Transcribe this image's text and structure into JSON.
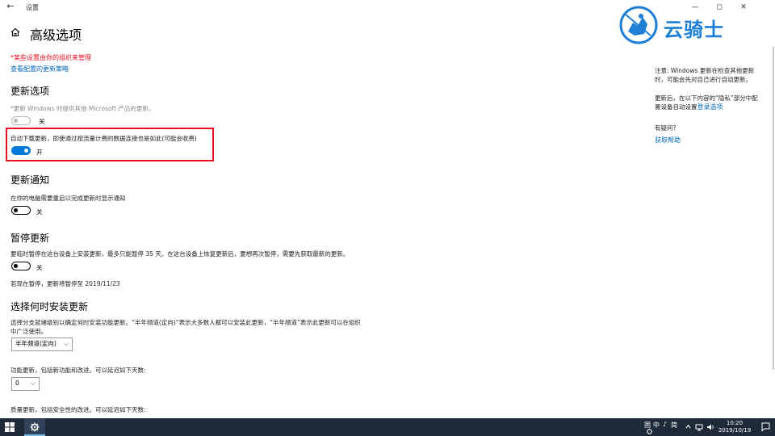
{
  "window": {
    "title": "设置",
    "back_glyph": "←",
    "minimize_glyph": "—",
    "maximize_glyph": "◻",
    "close_glyph": "✕"
  },
  "page": {
    "title": "高级选项",
    "managed_notice": "*某些设置由你的组织来管理",
    "policies_link": "查看配置的更新策略"
  },
  "update_options": {
    "heading": "更新选项",
    "other_products": {
      "label": "*更新 Windows 时提供其他 Microsoft 产品的更新。",
      "state": "关"
    },
    "metered_download": {
      "label": "自动下载更新，即使通过按流量计费的数据连接也是如此(可能会收费)",
      "state": "开"
    }
  },
  "update_notifications": {
    "heading": "更新通知",
    "restart_notify": {
      "label": "在你的电脑需要重启以完成更新时显示通知",
      "state": "关"
    }
  },
  "pause_updates": {
    "heading": "暂停更新",
    "description": "要临时暂停在这台设备上安装更新，最多只能暂停 35 天。在这台设备上恢复更新后，要想再次暂停，需要先获取最新的更新。",
    "state": "关",
    "pause_until": "若现在暂停，更新将暂停至 2019/11/23"
  },
  "install_timing": {
    "heading": "选择何时安装更新",
    "description_line1": "选择分支就绪级别以确定何时安装功能更新。“半年频道(定向)”表示大多数人都可以安装此更新，“半年频道”表示此更新可以在组织",
    "description_line2": "中广泛使用。",
    "channel_selected": "半年频道(定向)",
    "feature_label": "功能更新，包括新功能和改进。可以延迟如下天数:",
    "feature_days": "0",
    "quality_label": "质量更新，包括安全性的改进。可以延迟如下天数:"
  },
  "sidebar": {
    "note_line1": "注意: Windows 更新在检查其他更新",
    "note_line2": "时，可能会先对自己进行自动更新。",
    "privacy_line1": "更新后，在以下内容的“隐私”部分中配",
    "privacy_line2": "置设备自动设置",
    "login_link": "登录选项",
    "question": "有疑问?",
    "help_link": "获取帮助"
  },
  "logo": {
    "text": "云骑士",
    "color": "#1e7fd6"
  },
  "taskbar": {
    "ime_grid": "囲",
    "ime_lang": "中",
    "ime_punct": "♪",
    "ime_mode": "简",
    "time": "10:20",
    "date": "2019/10/19"
  },
  "colors": {
    "accent": "#0078d7",
    "link": "#0067b8",
    "warning": "#e81123",
    "taskbar": "#1f2a38"
  }
}
